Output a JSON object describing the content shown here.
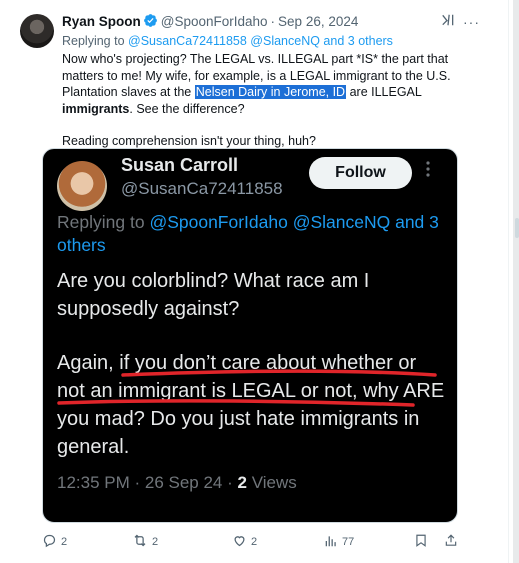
{
  "tweet": {
    "display_name": "Ryan Spoon",
    "handle": "@SpoonForIdaho",
    "separator": "·",
    "date": "Sep 26, 2024",
    "replying_prefix": "Replying to",
    "replying_handles": "@SusanCa72411858 @SlanceNQ and 3 others",
    "body_line1": "Now who's projecting? The LEGAL vs. ILLEGAL part *IS* the part that matters to me! My wife, for example, is a LEGAL immigrant to the U.S. Plantation slaves at the",
    "body_highlight": "Nelsen Dairy in Jerome, ID",
    "body_line2": "are ILLEGAL",
    "body_bold": "immigrants",
    "body_line3": ". See the difference?",
    "body_line4": "Reading comprehension isn't your thing, huh?"
  },
  "embedded": {
    "display_name": "Susan Carroll",
    "handle": "@SusanCa72411858",
    "follow_label": "Follow",
    "replying_prefix": "Replying to",
    "replying_handles": "@SpoonForIdaho @SlanceNQ and 3 others",
    "text1": "Are you colorblind? What race am I supposedly against?",
    "text2": "Again, if you don’t care about whether or not an immigrant is LEGAL or not, why ARE you mad? Do you just hate immigrants in general.",
    "meta_time": "12:35 PM · 26 Sep 24 · ",
    "meta_views_num": "2",
    "meta_views_label": " Views",
    "annotation_color": "#e0252a"
  },
  "actions": {
    "replies": "2",
    "reposts": "2",
    "likes": "2",
    "views": "77"
  },
  "colors": {
    "link": "#1d9bf0",
    "secondary": "#536471",
    "highlight": "#1d6fd6",
    "verified": "#1d9bf0"
  }
}
